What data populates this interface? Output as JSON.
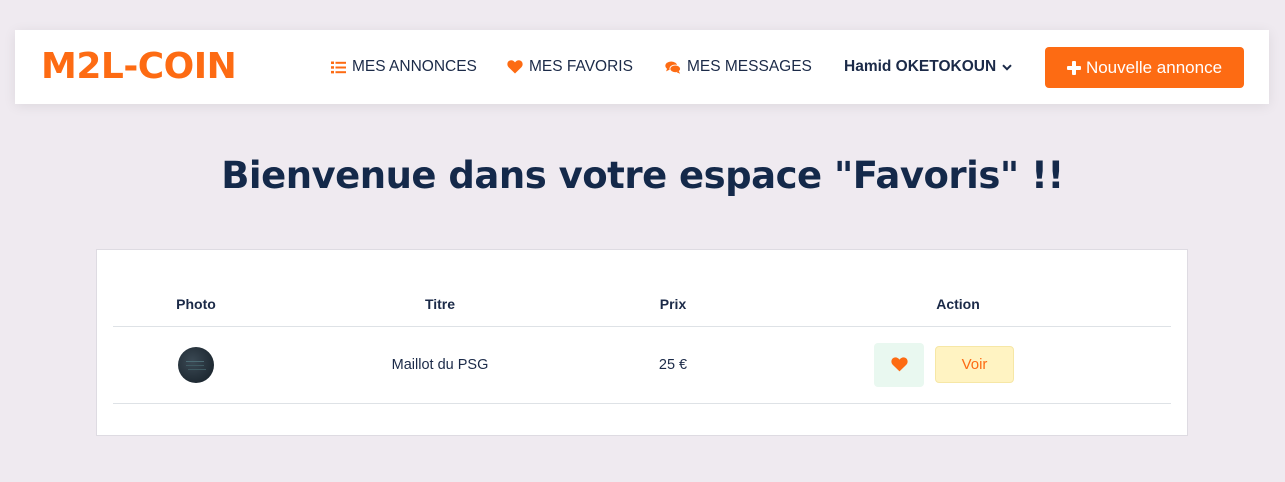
{
  "brand": {
    "name": "M2L-COIN",
    "color": "#fd6b13"
  },
  "nav": {
    "items": [
      {
        "label": "MES ANNONCES",
        "icon": "list-icon"
      },
      {
        "label": "MES FAVORIS",
        "icon": "heart-icon"
      },
      {
        "label": "MES MESSAGES",
        "icon": "comments-icon"
      }
    ],
    "user": {
      "name": "Hamid OKETOKOUN",
      "icon": "chevron-down-icon"
    },
    "new_listing_button": {
      "label": "Nouvelle annonce",
      "icon": "plus-icon"
    }
  },
  "page": {
    "title": "Bienvenue dans votre espace \"Favoris\" !!"
  },
  "favorites_table": {
    "headers": {
      "photo": "Photo",
      "title": "Titre",
      "price": "Prix",
      "action": "Action"
    },
    "rows": [
      {
        "title": "Maillot du PSG",
        "price": "25 €",
        "favorite_icon": "heart-icon",
        "view_label": "Voir"
      }
    ]
  },
  "colors": {
    "accent": "#fd6b13",
    "background": "#efeaf0",
    "text": "#1b2a48",
    "favorite_button_bg": "#e9f8f0",
    "view_button_bg": "#fff3c2"
  }
}
